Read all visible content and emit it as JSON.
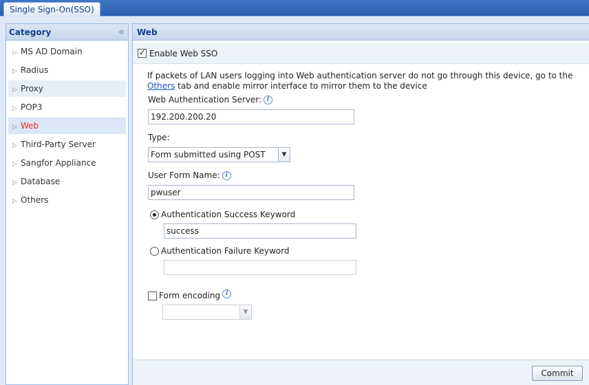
{
  "top_tabs": [
    {
      "label": "Single Sign-On(SSO)"
    }
  ],
  "category": {
    "title": "Category",
    "items": [
      {
        "label": "MS AD Domain"
      },
      {
        "label": "Radius"
      },
      {
        "label": "Proxy"
      },
      {
        "label": "POP3"
      },
      {
        "label": "Web"
      },
      {
        "label": "Third-Party Server"
      },
      {
        "label": "Sangfor Appliance"
      },
      {
        "label": "Database"
      },
      {
        "label": "Others"
      }
    ],
    "selected": "Web"
  },
  "web": {
    "title": "Web",
    "enable_label": "Enable Web SSO",
    "enable_checked": true,
    "description_before": "If packets of LAN users logging into Web authentication server do not go through this device, go to the ",
    "description_link": "Others",
    "description_after": " tab and enable mirror interface to mirror them to the device",
    "server_label": "Web Authentication Server:",
    "server_value": "192.200.200.20",
    "type_label": "Type:",
    "type_value": "Form submitted using POST",
    "user_form_label": "User Form Name:",
    "user_form_value": "pwuser",
    "success_label": "Authentication Success Keyword",
    "success_value": "success",
    "success_selected": true,
    "failure_label": "Authentication Failure Keyword",
    "failure_value": "",
    "failure_selected": false,
    "encoding_label": "Form encoding",
    "encoding_checked": false,
    "encoding_value": ""
  },
  "footer": {
    "commit_label": "Commit"
  },
  "colors": {
    "accent": "#15428b",
    "selected_text": "#e03524",
    "link": "#1a55b8"
  }
}
